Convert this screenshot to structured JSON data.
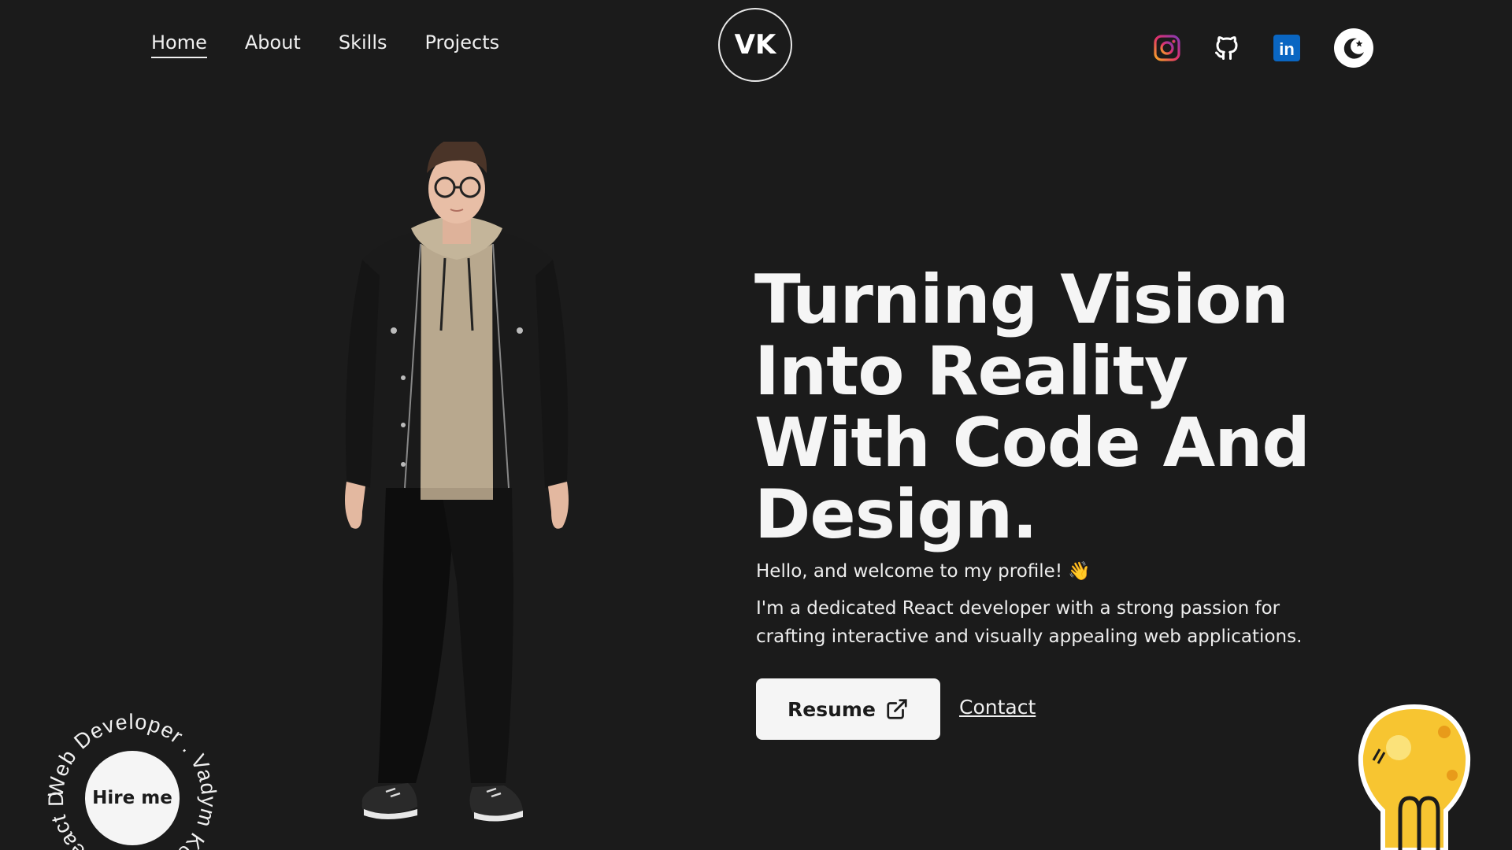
{
  "nav": {
    "links": [
      "Home",
      "About",
      "Skills",
      "Projects"
    ],
    "active": "Home",
    "logo": "VK"
  },
  "socials": {
    "icons": [
      "instagram-icon",
      "github-icon",
      "linkedin-icon"
    ],
    "theme_toggle_icon": "moon-star-icon",
    "linkedin_glyph": "in"
  },
  "hero": {
    "headline_lines": [
      "Turning Vision",
      "Into Reality",
      "With Code And",
      "Design."
    ],
    "greeting": "Hello, and welcome to my profile! 👋",
    "intro": "I'm a dedicated React developer with a strong passion for crafting interactive and visually appealing web applications.",
    "resume_label": "Resume",
    "contact_label": "Contact"
  },
  "hire": {
    "label": "Hire me",
    "ring_text": "Web Developer . Vadym Kobylian . React Developer . "
  },
  "colors": {
    "background": "#1b1b1b",
    "text": "#f5f5f5",
    "linkedin": "#0a66c2",
    "bulb": "#f7c531"
  }
}
